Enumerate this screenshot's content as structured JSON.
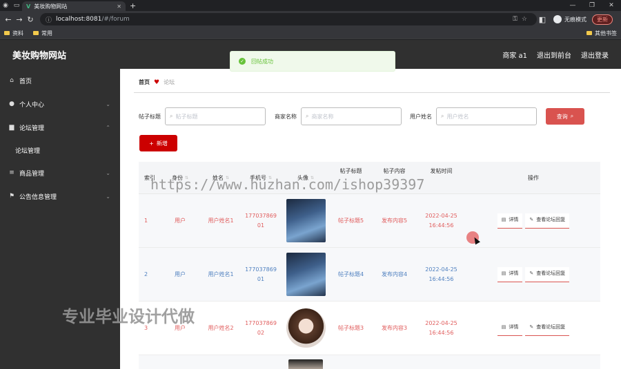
{
  "browser": {
    "tab_title": "美妆购物网站",
    "url_host": "localhost:8081",
    "url_path": "/#/forum",
    "profile_label": "无痕模式",
    "update_label": "更新",
    "bookmarks": [
      "资料",
      "常用"
    ],
    "bookmark_right": "其他书签"
  },
  "header": {
    "site_title": "美妆购物网站",
    "user": "商家 a1",
    "back_front": "退出到前台",
    "logout": "退出登录"
  },
  "toast": {
    "message": "回帖成功"
  },
  "sidebar": {
    "items": [
      {
        "label": "首页",
        "icon": "home-icon"
      },
      {
        "label": "个人中心",
        "icon": "user-icon"
      },
      {
        "label": "论坛管理",
        "icon": "forum-icon"
      },
      {
        "label": "论坛管理",
        "icon": ""
      },
      {
        "label": "商品管理",
        "icon": "list-icon"
      },
      {
        "label": "公告信息管理",
        "icon": "flag-icon"
      }
    ]
  },
  "breadcrumb": {
    "home": "首页",
    "current": "论坛"
  },
  "search": {
    "title_label": "帖子标题",
    "title_placeholder": "帖子标题",
    "merchant_label": "商家名称",
    "merchant_placeholder": "商家名称",
    "user_label": "用户姓名",
    "user_placeholder": "用户姓名",
    "query_button": "查询",
    "add_button": "新增"
  },
  "table": {
    "headers": [
      "索引",
      "身份",
      "姓名",
      "手机号",
      "头像",
      "帖子标题",
      "帖子内容",
      "发帖时间",
      "操作"
    ],
    "rows": [
      {
        "index": "1",
        "role": "用户",
        "name": "用户姓名1",
        "phone_a": "177037869",
        "phone_b": "01",
        "title": "帖子标题5",
        "content": "发布内容5",
        "date": "2022-04-25",
        "time": "16:44:56"
      },
      {
        "index": "2",
        "role": "用户",
        "name": "用户姓名1",
        "phone_a": "177037869",
        "phone_b": "01",
        "title": "帖子标题4",
        "content": "发布内容4",
        "date": "2022-04-25",
        "time": "16:44:56"
      },
      {
        "index": "3",
        "role": "用户",
        "name": "用户姓名2",
        "phone_a": "177037869",
        "phone_b": "02",
        "title": "帖子标题3",
        "content": "发布内容3",
        "date": "2022-04-25",
        "time": "16:44:56"
      }
    ],
    "detail_button": "详情",
    "reply_button": "查看论坛回复"
  },
  "overlays": {
    "watermark": "https://www.huzhan.com/ishop39397",
    "promo": "专业毕业设计代做"
  }
}
